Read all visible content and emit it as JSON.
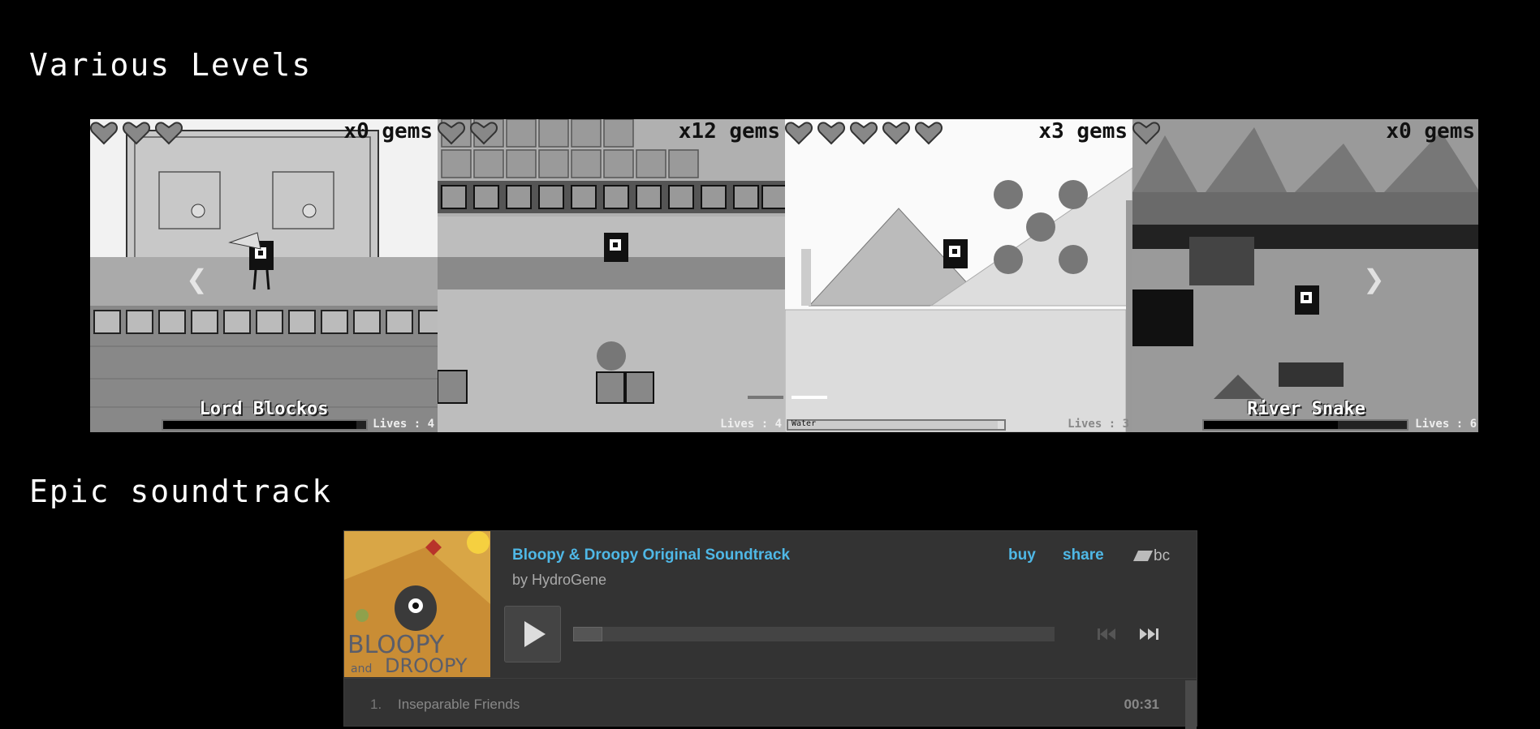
{
  "sections": {
    "levels_title": "Various Levels",
    "soundtrack_title": "Epic soundtrack"
  },
  "carousel": {
    "slides": [
      {
        "gems": "x0 gems",
        "name": "Lord Blockos",
        "lives": "Lives : 4",
        "hearts": 3,
        "bar_fill": 0.95
      },
      {
        "gems": "x12 gems",
        "name": "",
        "lives": "Lives : 4",
        "hearts": 2
      },
      {
        "gems": "x3 gems",
        "name": "",
        "lives": "Lives : 3",
        "hearts": 5,
        "bar_label": "Water",
        "bar_fill": 0.97
      },
      {
        "gems": "x0 gems",
        "name": "River Snake",
        "lives": "Lives : 6",
        "hearts": 1,
        "bar_fill": 0.66
      }
    ],
    "prev_icon": "chevron-left-icon",
    "next_icon": "chevron-right-icon",
    "indicators": 2,
    "active_indicator": 1
  },
  "player": {
    "album_title": "Bloopy & Droopy Original Soundtrack",
    "artist": "by HydroGene",
    "buy_label": "buy",
    "share_label": "share",
    "logo_text": "bc",
    "accent_color": "#4fb8e6",
    "album_art_text": {
      "line1": "BLOOPY",
      "line2": "and",
      "line3": "DROOPY"
    },
    "progress": 0,
    "tracks": [
      {
        "num": "1.",
        "title": "Inseparable Friends",
        "time": "00:31"
      }
    ]
  }
}
